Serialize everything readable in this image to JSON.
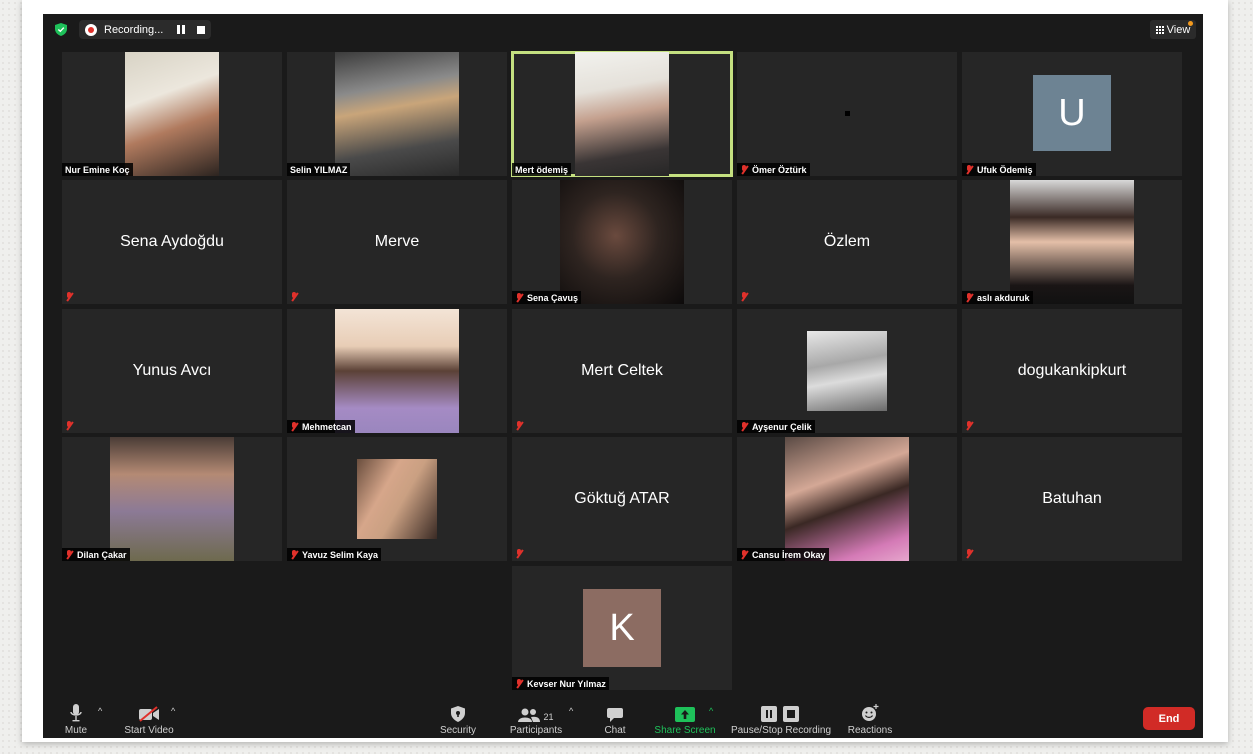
{
  "topbar": {
    "recording_label": "Recording...",
    "view_label": "View"
  },
  "participants": [
    {
      "name": "Nur Emine Koç",
      "video": true,
      "muted": false
    },
    {
      "name": "Selin YILMAZ",
      "video": true,
      "muted": false
    },
    {
      "name": "Mert  ödemiş",
      "video": true,
      "muted": false,
      "active_speaker": true
    },
    {
      "name": "Ömer Öztürk",
      "video": true,
      "muted": true
    },
    {
      "name": "Ufuk Ödemiş",
      "video": false,
      "muted": true,
      "avatar_letter": "U",
      "avatar_color": "#6d8393"
    },
    {
      "name": "Sena Aydoğdu",
      "video": false,
      "muted": true
    },
    {
      "name": "Merve",
      "video": false,
      "muted": true
    },
    {
      "name": "Sena Çavuş",
      "video": true,
      "muted": true
    },
    {
      "name": "Özlem",
      "video": false,
      "muted": true
    },
    {
      "name": "aslı akduruk",
      "video": true,
      "muted": true
    },
    {
      "name": "Yunus Avcı",
      "video": false,
      "muted": true
    },
    {
      "name": "Mehmetcan",
      "video": true,
      "muted": true
    },
    {
      "name": "Mert Celtek",
      "video": false,
      "muted": true
    },
    {
      "name": "Ayşenur Çelik",
      "video": true,
      "muted": true
    },
    {
      "name": "dogukankipkurt",
      "video": false,
      "muted": true
    },
    {
      "name": "Dilan Çakar",
      "video": true,
      "muted": true
    },
    {
      "name": "Yavuz Selim Kaya",
      "video": true,
      "muted": true
    },
    {
      "name": "Göktuğ ATAR",
      "video": false,
      "muted": true
    },
    {
      "name": "Cansu İrem Okay",
      "video": true,
      "muted": true
    },
    {
      "name": "Batuhan",
      "video": false,
      "muted": true
    },
    {
      "name": "Kevser Nur Yılmaz",
      "video": false,
      "muted": true,
      "avatar_letter": "K",
      "avatar_color": "#8c6c62"
    }
  ],
  "toolbar": {
    "mute": "Mute",
    "start_video": "Start Video",
    "security": "Security",
    "participants": "Participants",
    "participants_count": "21",
    "chat": "Chat",
    "share_screen": "Share Screen",
    "recording": "Pause/Stop Recording",
    "reactions": "Reactions",
    "end": "End"
  },
  "colors": {
    "accent_green": "#1ec15a",
    "end_red": "#d12b26",
    "active_outline": "#c4e080",
    "muted_red": "#e0312b"
  }
}
